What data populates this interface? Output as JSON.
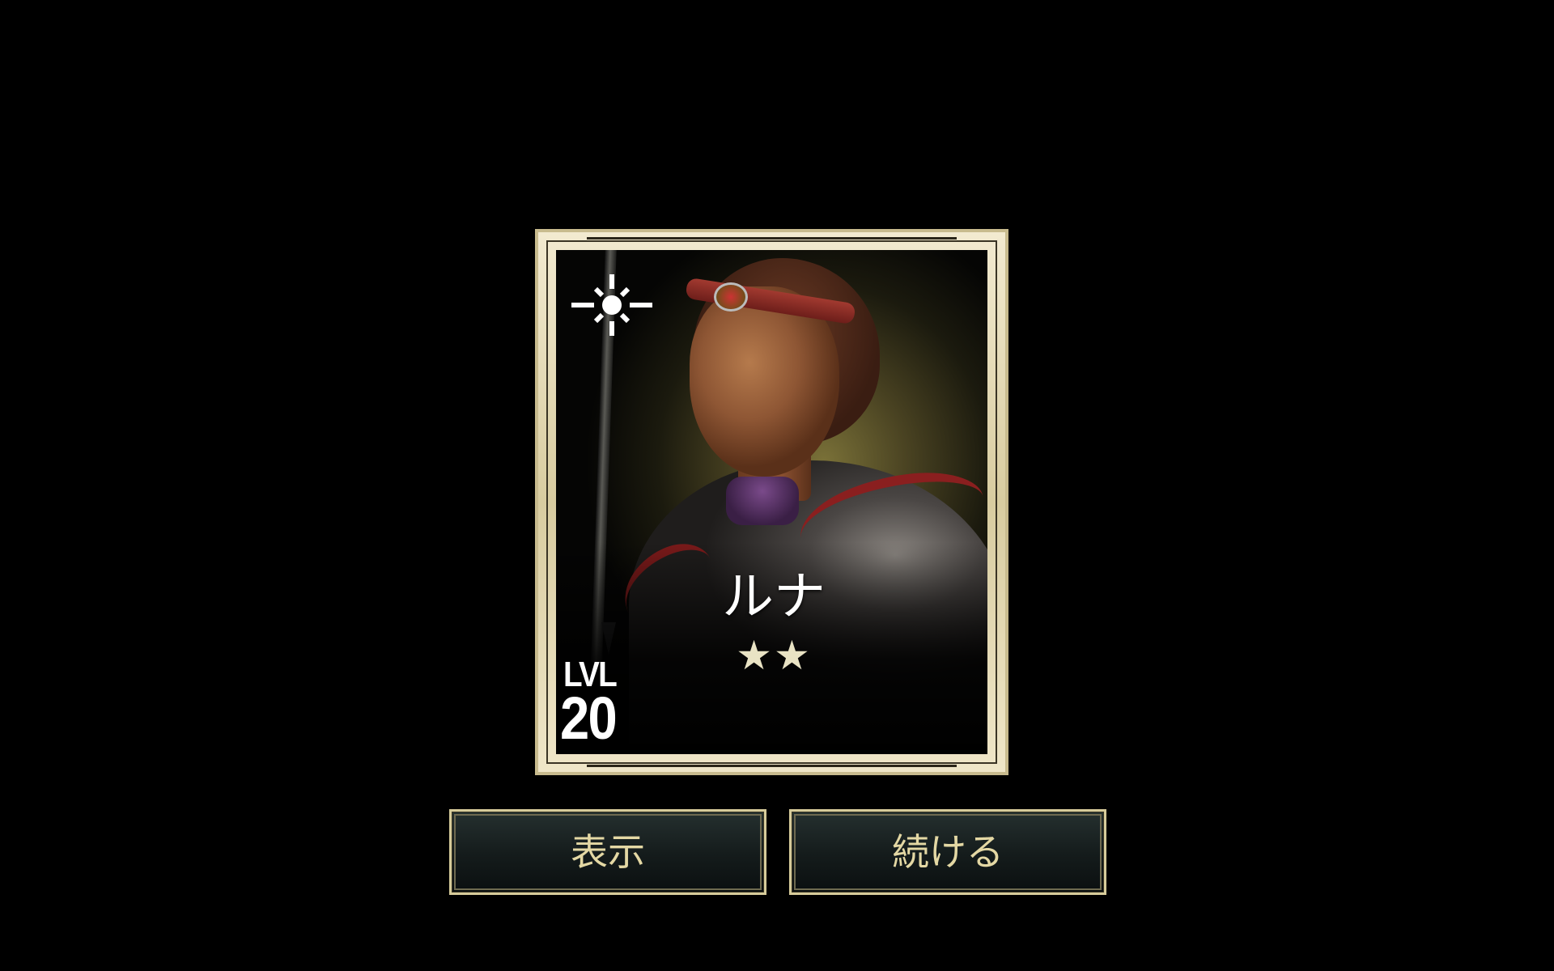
{
  "hero": {
    "name": "ルナ",
    "stars": "★★",
    "star_count": 2,
    "level_label": "LVL",
    "level": "20",
    "element_icon": "sun-icon"
  },
  "buttons": {
    "view_label": "表示",
    "continue_label": "続ける"
  },
  "colors": {
    "background": "#000000",
    "frame": "#e6dcb8",
    "button_text": "#e4d8a4",
    "button_bg": "#182020"
  }
}
